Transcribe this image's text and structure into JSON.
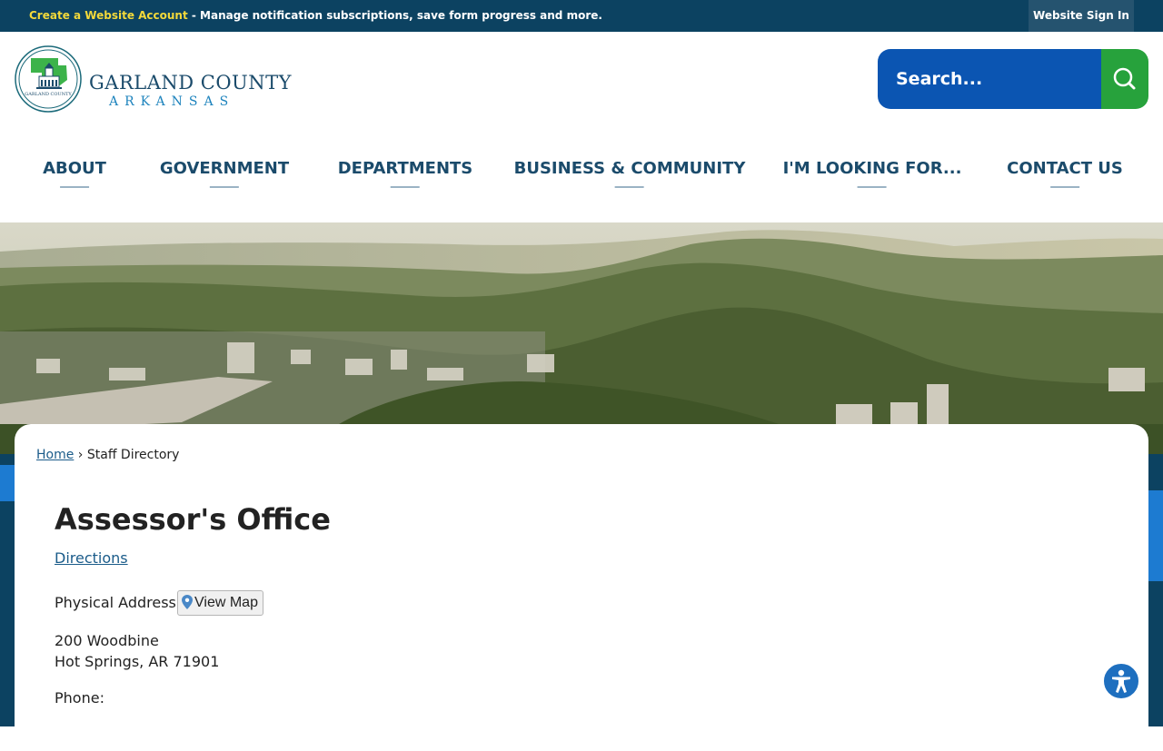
{
  "topbar": {
    "create_account": "Create a Website Account",
    "message": " - Manage notification subscriptions, save form progress and more.",
    "signin_label": "Website Sign In"
  },
  "logo": {
    "line1": "GARLAND COUNTY",
    "line2": "ARKANSAS",
    "seal_text": "GARLAND COUNTY"
  },
  "search": {
    "placeholder": "Search..."
  },
  "nav": {
    "items": [
      {
        "label": "ABOUT"
      },
      {
        "label": "GOVERNMENT"
      },
      {
        "label": "DEPARTMENTS"
      },
      {
        "label": "BUSINESS & COMMUNITY"
      },
      {
        "label": "I'M LOOKING FOR..."
      },
      {
        "label": "CONTACT US"
      }
    ]
  },
  "breadcrumb": {
    "home": "Home",
    "separator": "›",
    "current": "Staff Directory"
  },
  "office": {
    "title": "Assessor's Office",
    "directions": "Directions",
    "physical_label": "Physical Address:",
    "view_map": "View Map",
    "address_line1": "200 Woodbine",
    "address_line2": "Hot Springs, AR 71901",
    "phone_label": "Phone:"
  },
  "colors": {
    "topbar": "#0c4261",
    "create_account": "#f3d93a",
    "search_blue": "#0b55b2",
    "search_green": "#27a23c",
    "nav_text": "#1b4b6b",
    "link": "#1b5c8a",
    "accessibility": "#1e6fbf"
  },
  "icons": {
    "search": "magnifier-icon",
    "map": "map-pin-icon",
    "accessibility": "accessibility-person-icon"
  }
}
